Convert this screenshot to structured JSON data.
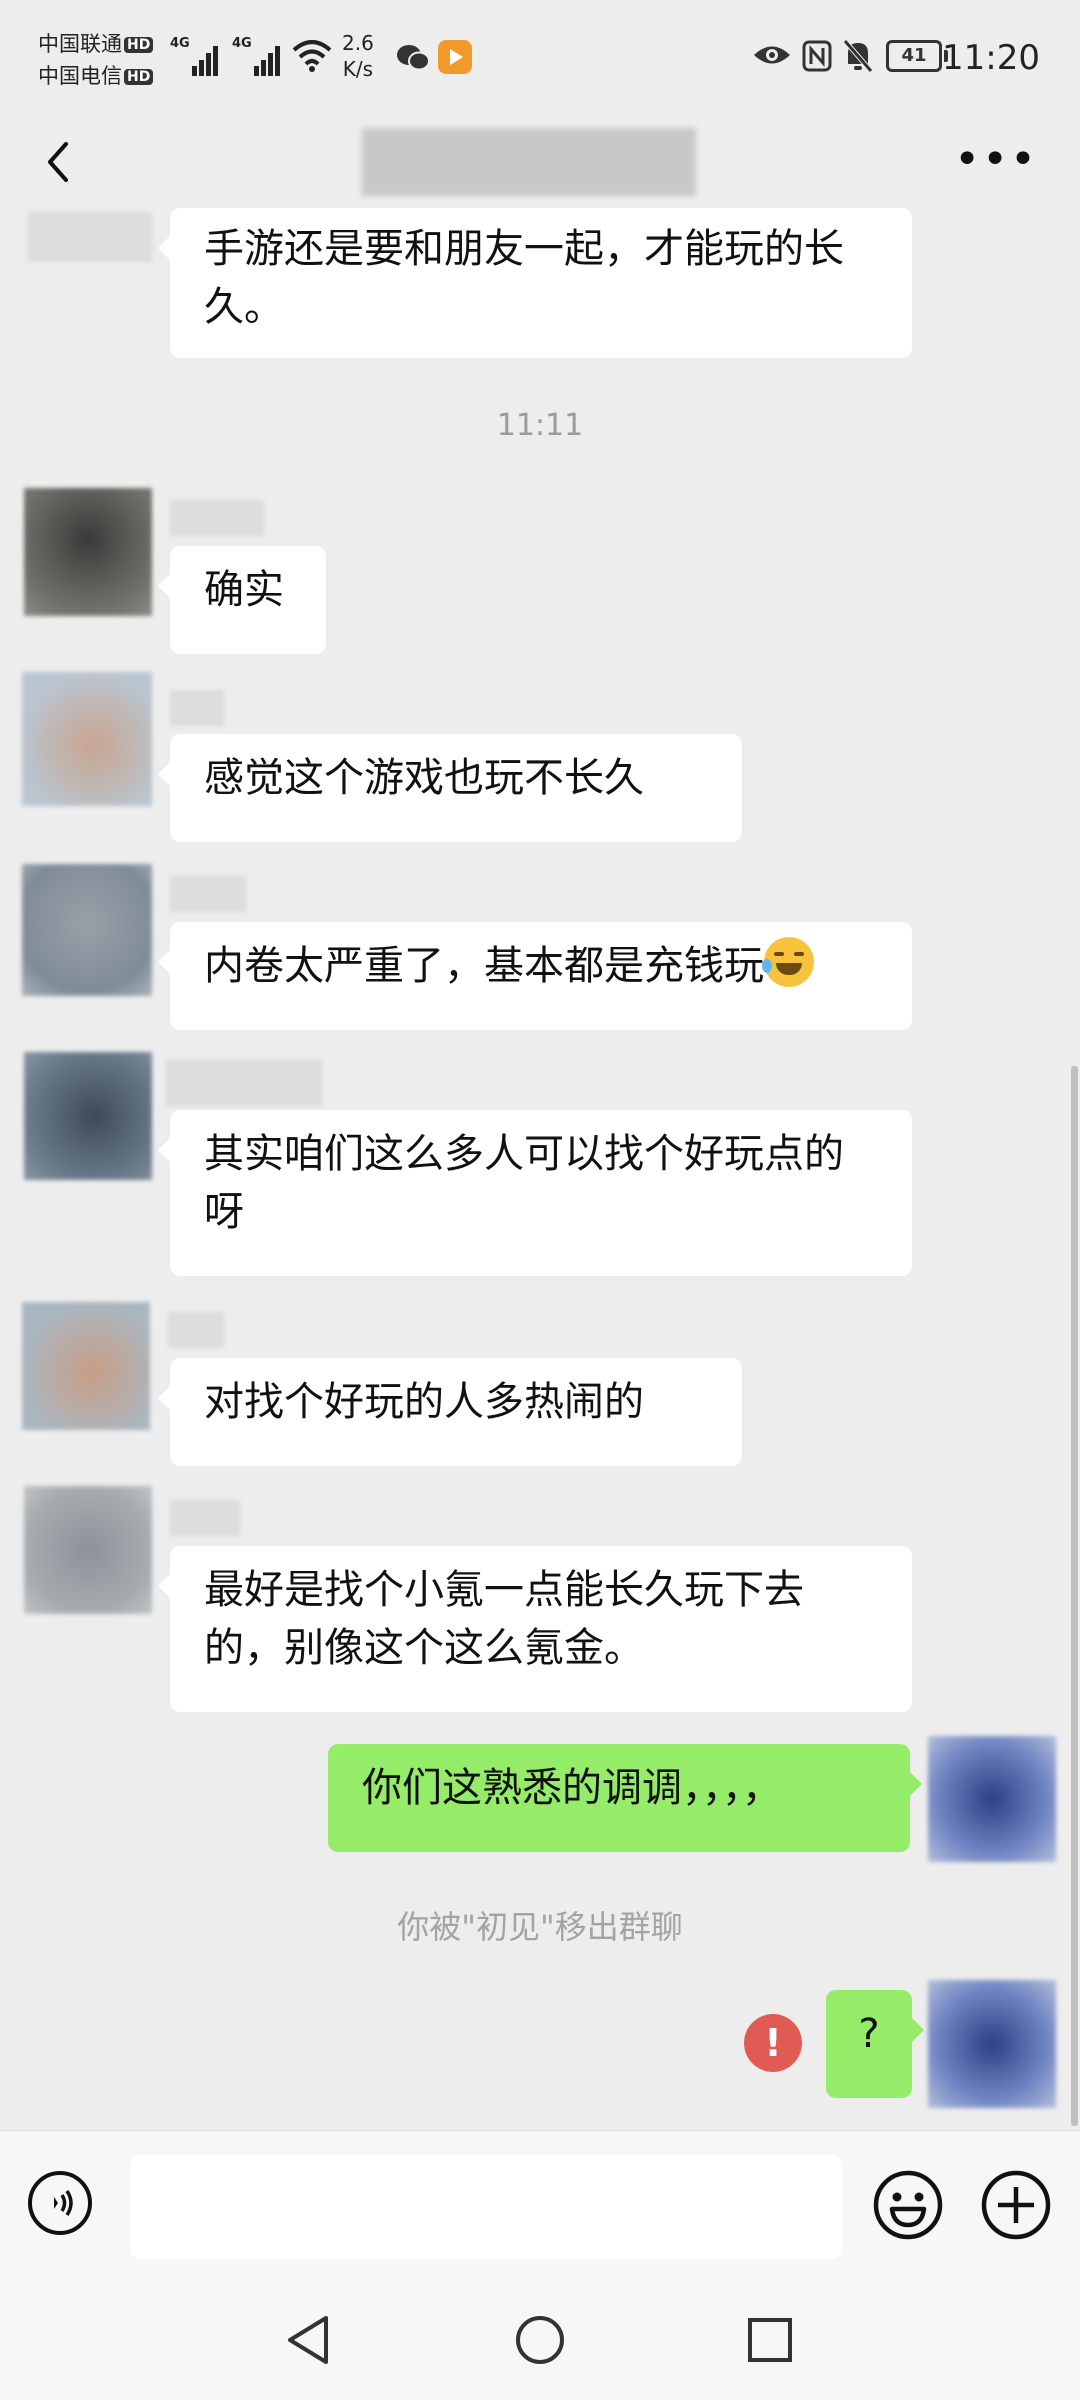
{
  "status_bar": {
    "carrier_1": "中国联通",
    "carrier_2": "中国电信",
    "hd_badge": "HD",
    "network_1": "4G",
    "network_2": "4G",
    "speed_value": "2.6",
    "speed_unit": "K/s",
    "battery": "41",
    "time": "11:20"
  },
  "messages": {
    "m0": "手游还是要和朋友一起，才能玩的长久。",
    "timestamp": "11:11",
    "m1": "确实",
    "m2": "感觉这个游戏也玩不长久",
    "m3": "内卷太严重了，基本都是充钱玩",
    "m4": "其实咱们这么多人可以找个好玩点的呀",
    "m5": "对找个好玩的人多热闹的",
    "m6": "最好是找个小氪一点能长久玩下去的，别像这个这么氪金。",
    "m7": "你们这熟悉的调调，，，，",
    "system_notice": "你被\"初见\"移出群聊",
    "m8": "?",
    "error_mark": "!"
  },
  "colors": {
    "background": "#ededed",
    "my_bubble": "#95ec69",
    "other_bubble": "#ffffff",
    "error": "#e15b55"
  },
  "icons": [
    "back-icon",
    "more-icon",
    "voice-icon",
    "emoji-icon",
    "plus-icon",
    "nav-back-icon",
    "nav-home-icon",
    "nav-recents-icon"
  ]
}
